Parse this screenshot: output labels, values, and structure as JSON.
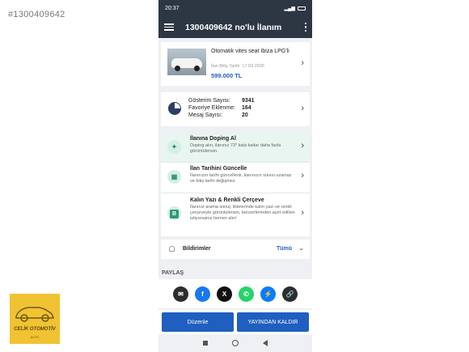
{
  "watermark": "#1300409642",
  "logo": {
    "name": "CELİK OTOMOTİV",
    "sub": "AUTO"
  },
  "status_bar": {
    "time": "20:37",
    "battery": ""
  },
  "app_bar": {
    "title": "1300409642 no'lu İlanım"
  },
  "listing": {
    "title": "Otomatik vites seat Ibiza LPG'li",
    "end_date": "İlan Bitiş Tarihi: 17.03.2026",
    "price": "599.000 TL"
  },
  "stats": {
    "views_label": "Gösterim Sayısı:",
    "views_value": "9341",
    "favorites_label": "Favoriye Eklenme:",
    "favorites_value": "164",
    "messages_label": "Mesaj Sayısı:",
    "messages_value": "20"
  },
  "promos": [
    {
      "title": "İlanına Doping Al",
      "desc": "Doping alın, ilanınız 73* kata kadar daha fazla görüntülensin."
    },
    {
      "title": "İlan Tarihini Güncelle",
      "desc": "İlanınızın tarihi güncellenir, ilanınızın süresi uzamaz ve bitiş tarihi değişmez."
    },
    {
      "title": "Kalın Yazı & Renkli Çerçeve",
      "desc": "İlanınız arama sonuç listelerinde kalın yazı ve renkli çerçeveyle görüntülensin, benzerlerinden ayırt edilsin istiyorsanız hemen alın!"
    }
  ],
  "notifications": {
    "label": "Bildirimler",
    "filter": "Tümü"
  },
  "share": {
    "label": "PAYLAŞ",
    "buttons": [
      {
        "icon": "email-icon",
        "glyph": "✉",
        "color": "#2d2d2d"
      },
      {
        "icon": "facebook-icon",
        "glyph": "f",
        "color": "#1877f2"
      },
      {
        "icon": "x-icon",
        "glyph": "X",
        "color": "#111111"
      },
      {
        "icon": "whatsapp-icon",
        "glyph": "✆",
        "color": "#25d366"
      },
      {
        "icon": "messenger-icon",
        "glyph": "⚡",
        "color": "#0a7cff"
      },
      {
        "icon": "link-icon",
        "glyph": "🔗",
        "color": "#2d2d2d"
      }
    ]
  },
  "actions": {
    "edit": "Düzenle",
    "unpublish": "YAYINDAN KALDIR"
  },
  "colors": {
    "header": "#2d3744",
    "accent": "#1f5fbf",
    "promo_highlight": "#e8f5f1"
  }
}
